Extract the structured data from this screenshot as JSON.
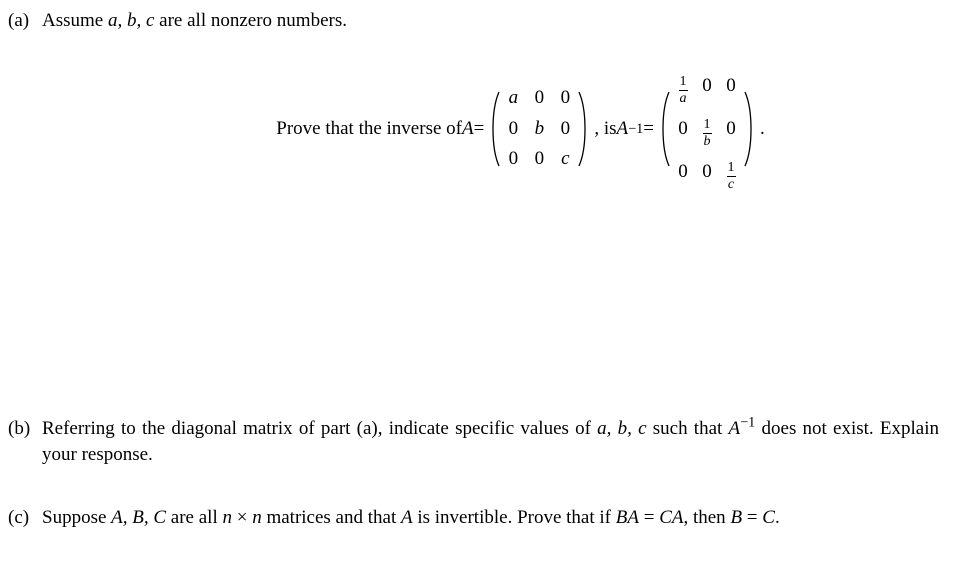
{
  "partA": {
    "label": "(a)",
    "intro_pre": "Assume ",
    "intro_vars": "a, b, c",
    "intro_post": " are all nonzero numbers.",
    "prove_text": "Prove that the inverse of ",
    "A_eq": "A",
    "equals1": " = ",
    "matrix1": {
      "r1": [
        "a",
        "0",
        "0"
      ],
      "r2": [
        "0",
        "b",
        "0"
      ],
      "r3": [
        "0",
        "0",
        "c"
      ]
    },
    "comma_is": ", is ",
    "Ainv": "A",
    "Ainv_sup": "−1",
    "equals2": " = ",
    "matrix2": {
      "r1": [
        {
          "frac": [
            "1",
            "a"
          ]
        },
        "0",
        "0"
      ],
      "r2": [
        "0",
        {
          "frac": [
            "1",
            "b"
          ]
        },
        "0"
      ],
      "r3": [
        "0",
        "0",
        {
          "frac": [
            "1",
            "c"
          ]
        }
      ]
    },
    "period": "."
  },
  "partB": {
    "label": "(b)",
    "text_pre": "Referring to the diagonal matrix of part (a), indicate specific values of ",
    "vars": "a, b, c",
    "text_mid": " such that ",
    "Ainv": "A",
    "Ainv_sup": "−1",
    "text_post": " does not exist. Explain your response."
  },
  "partC": {
    "label": "(c)",
    "pre": "Suppose ",
    "ABC": "A, B, C",
    "mid1": " are all ",
    "n": "n",
    "times": " × ",
    "n2": "n",
    "mid2": " matrices and that ",
    "A": "A",
    "mid3": " is invertible. Prove that if ",
    "BA": "BA",
    "eq1": " = ",
    "CA": "CA",
    "comma": ", then ",
    "B": "B",
    "eq2": " = ",
    "C": "C",
    "period": "."
  }
}
